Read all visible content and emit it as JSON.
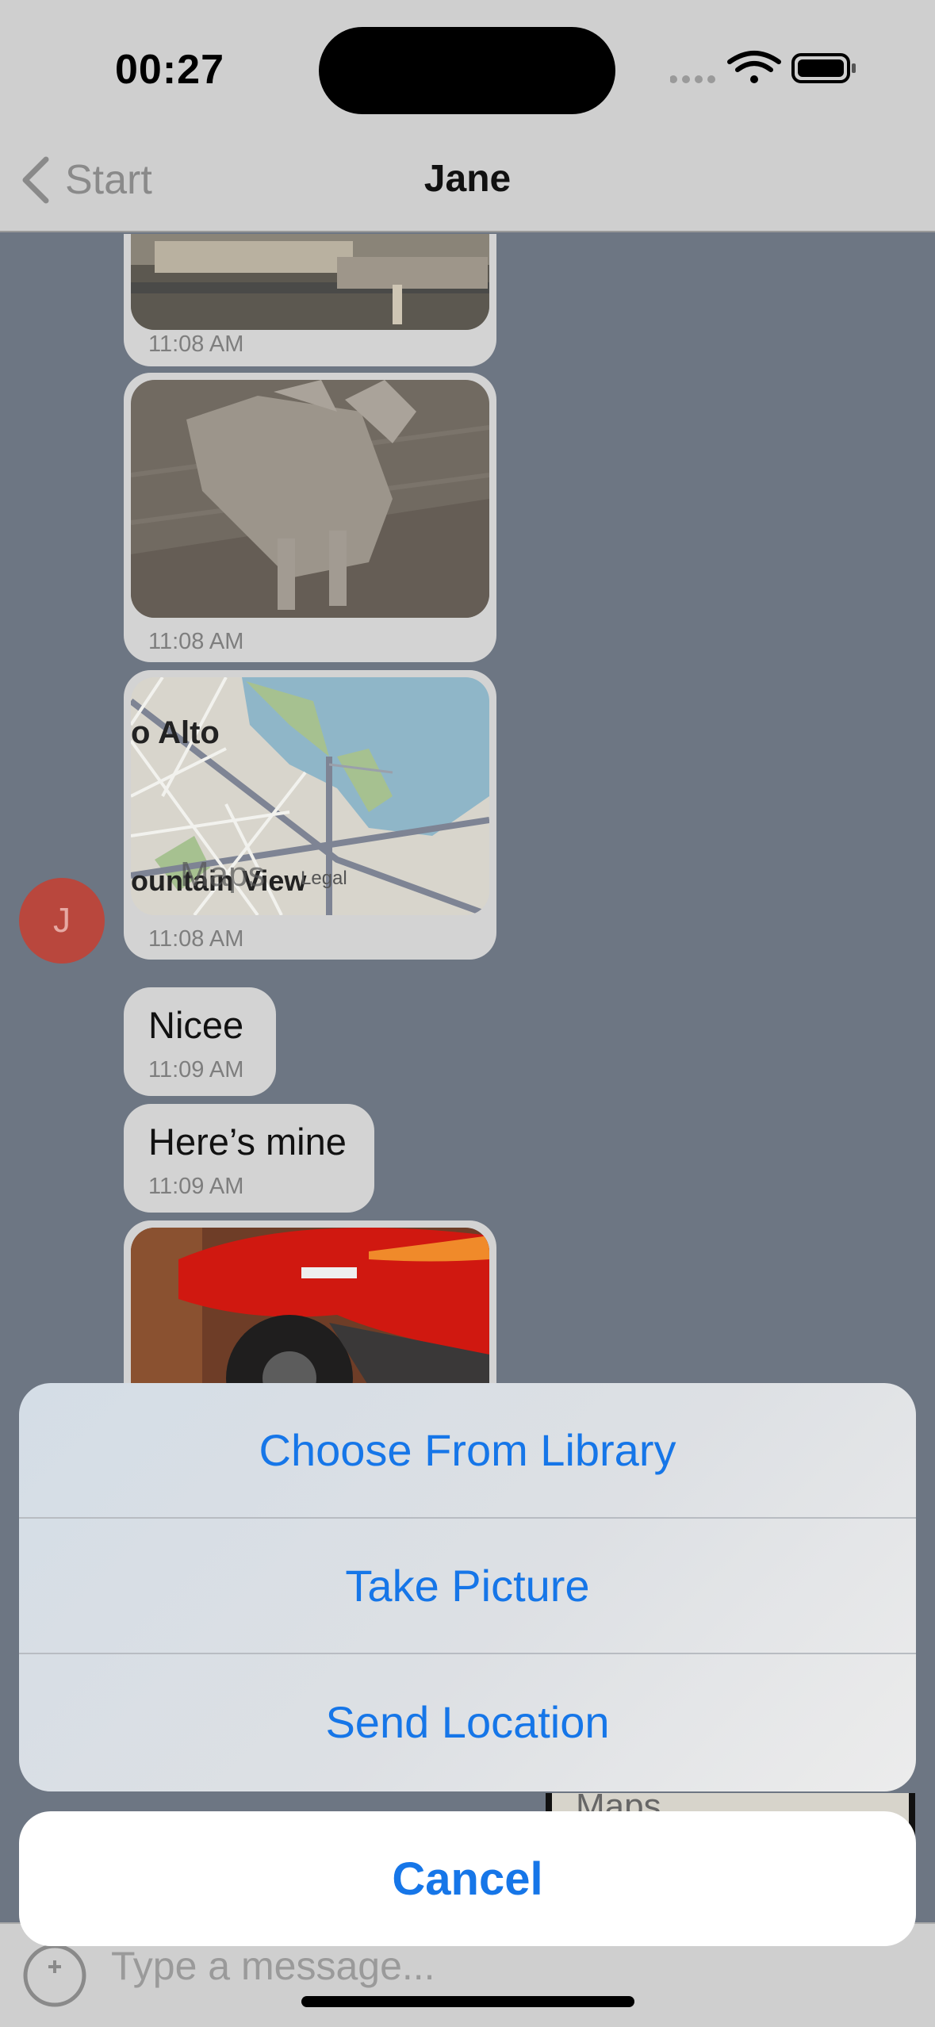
{
  "status_bar": {
    "time": "00:27"
  },
  "nav": {
    "back_label": "Start",
    "title": "Jane"
  },
  "messages": [
    {
      "kind": "image",
      "content": "living room photo",
      "time": "11:08 AM"
    },
    {
      "kind": "image",
      "content": "low-poly dog photo",
      "time": "11:08 AM"
    },
    {
      "kind": "map",
      "place_top": "o Alto",
      "place_bottom": "ountain View",
      "brand": "Maps",
      "legal": "Legal",
      "time": "11:08 AM"
    },
    {
      "kind": "text",
      "text": "Nicee",
      "time": "11:09 AM"
    },
    {
      "kind": "text",
      "text": "Here’s mine",
      "time": "11:09 AM"
    },
    {
      "kind": "image",
      "content": "red motorcycle photo"
    }
  ],
  "avatar": {
    "initial": "J",
    "color": "#b9473d"
  },
  "peek_map": {
    "brand": "Maps"
  },
  "composer": {
    "placeholder": "Type a message..."
  },
  "action_sheet": {
    "options": [
      "Choose From Library",
      "Take Picture",
      "Send Location"
    ],
    "cancel_label": "Cancel"
  },
  "colors": {
    "accent": "#1676e8",
    "chat_background": "#6d7683",
    "bubble": "#d3d3d3"
  }
}
